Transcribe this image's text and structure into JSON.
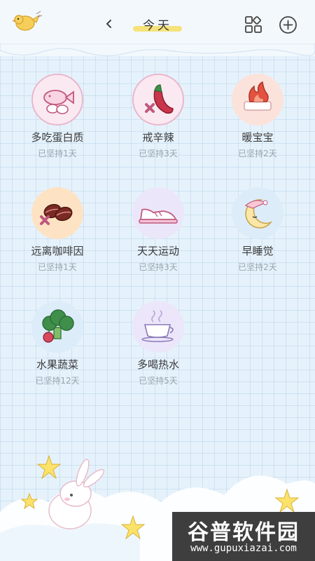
{
  "header": {
    "title": "今天",
    "back_icon": "chevron-left-icon",
    "grid_icon": "category-grid-icon",
    "add_icon": "plus-circle-icon"
  },
  "habits": [
    {
      "name": "多吃蛋白质",
      "streak": "已坚持1天",
      "icon": "fish-egg-icon",
      "bg": "#fbe9f1"
    },
    {
      "name": "戒辛辣",
      "streak": "已坚持3天",
      "icon": "chili-pepper-icon",
      "bg": "#fbe9f1"
    },
    {
      "name": "暖宝宝",
      "streak": "已坚持2天",
      "icon": "flame-icon",
      "bg": "#fbe3dc"
    },
    {
      "name": "远离咖啡因",
      "streak": "已坚持1天",
      "icon": "coffee-bean-icon",
      "bg": "#fde3c4"
    },
    {
      "name": "天天运动",
      "streak": "已坚持3天",
      "icon": "sneaker-icon",
      "bg": "#ece6fa"
    },
    {
      "name": "早睡觉",
      "streak": "已坚持2天",
      "icon": "moon-icon",
      "bg": "#dcecf9"
    },
    {
      "name": "水果蔬菜",
      "streak": "已坚持12天",
      "icon": "broccoli-icon",
      "bg": "#dcecf9"
    },
    {
      "name": "多喝热水",
      "streak": "已坚持5天",
      "icon": "hot-cup-icon",
      "bg": "#ece6fa"
    }
  ],
  "watermark": {
    "main": "谷普软件园",
    "url": "www.gupuxiazai.com"
  }
}
